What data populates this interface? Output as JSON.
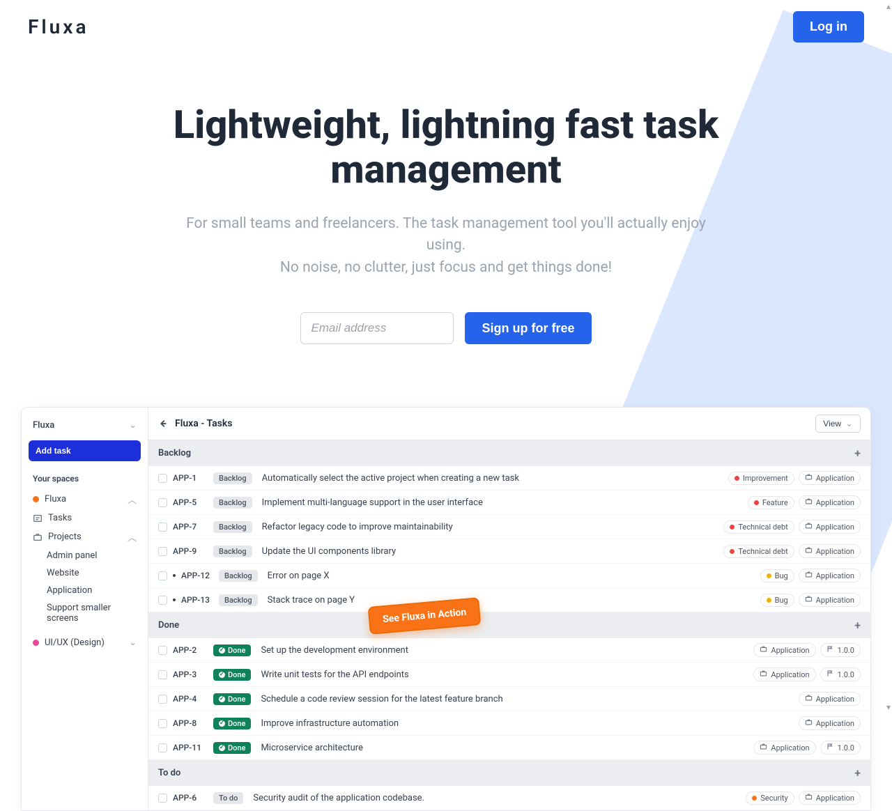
{
  "header": {
    "brand": "Fluxa",
    "login_label": "Log in"
  },
  "hero": {
    "title": "Lightweight, lightning fast task management",
    "subtitle_line1": "For small teams and freelancers. The task management tool you'll actually enjoy using.",
    "subtitle_line2": "No noise, no clutter, just focus and get things done!",
    "email_placeholder": "Email address",
    "signup_label": "Sign up for free"
  },
  "app": {
    "workspace": "Fluxa",
    "add_task_label": "Add task",
    "spaces_label": "Your spaces",
    "sidebar": {
      "fluxa": "Fluxa",
      "tasks": "Tasks",
      "projects": "Projects",
      "admin_panel": "Admin panel",
      "website": "Website",
      "application": "Application",
      "support_smaller": "Support smaller screens",
      "uiux": "UI/UX (Design)"
    },
    "panel_title": "Fluxa - Tasks",
    "view_label": "View",
    "sections": {
      "backlog": "Backlog",
      "done": "Done",
      "todo": "To do"
    },
    "status_labels": {
      "backlog": "Backlog",
      "done": "Done",
      "todo": "To do"
    },
    "tag_labels": {
      "improvement": "Improvement",
      "feature": "Feature",
      "technical_debt": "Technical debt",
      "bug": "Bug",
      "security": "Security",
      "application": "Application",
      "version": "1.0.0"
    },
    "tasks": {
      "backlog": [
        {
          "id": "APP-1",
          "title": "Automatically select the active project when creating a new task",
          "type": "improvement",
          "type_color": "red"
        },
        {
          "id": "APP-5",
          "title": "Implement multi-language support in the user interface",
          "type": "feature",
          "type_color": "red"
        },
        {
          "id": "APP-7",
          "title": "Refactor legacy code to improve maintainability",
          "type": "technical_debt",
          "type_color": "red"
        },
        {
          "id": "APP-9",
          "title": "Update the UI components library",
          "type": "technical_debt",
          "type_color": "red"
        },
        {
          "id": "APP-12",
          "title": "Error on page X",
          "type": "bug",
          "type_color": "yellow",
          "blocker": true
        },
        {
          "id": "APP-13",
          "title": "Stack trace on page Y",
          "type": "bug",
          "type_color": "yellow",
          "blocker": true
        }
      ],
      "done": [
        {
          "id": "APP-2",
          "title": "Set up the development environment",
          "version": true
        },
        {
          "id": "APP-3",
          "title": "Write unit tests for the API endpoints",
          "version": true
        },
        {
          "id": "APP-4",
          "title": "Schedule a code review session for the latest feature branch"
        },
        {
          "id": "APP-8",
          "title": "Improve infrastructure automation"
        },
        {
          "id": "APP-11",
          "title": "Microservice architecture",
          "version": true
        }
      ],
      "todo": [
        {
          "id": "APP-6",
          "title": "Security audit of the application codebase.",
          "type": "security",
          "type_color": "orange"
        }
      ]
    },
    "sticker": "See Fluxa in Action"
  }
}
